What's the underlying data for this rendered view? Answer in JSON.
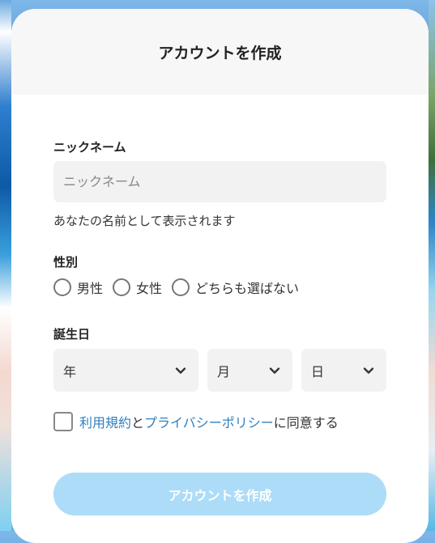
{
  "header": {
    "title": "アカウントを作成"
  },
  "nickname": {
    "label": "ニックネーム",
    "placeholder": "ニックネーム",
    "value": "",
    "help": "あなたの名前として表示されます"
  },
  "gender": {
    "label": "性別",
    "options": [
      "男性",
      "女性",
      "どちらも選ばない"
    ]
  },
  "birthday": {
    "label": "誕生日",
    "year": "年",
    "month": "月",
    "day": "日"
  },
  "agreement": {
    "terms_link": "利用規約",
    "and": "と",
    "privacy_link": "プライバシーポリシー",
    "suffix": "に同意する"
  },
  "submit": {
    "label": "アカウントを作成"
  },
  "colors": {
    "accent": "#2f7fbf",
    "button_disabled": "#acdcf8",
    "field_bg": "#f2f2f2",
    "header_bg": "#f7f7f7"
  }
}
